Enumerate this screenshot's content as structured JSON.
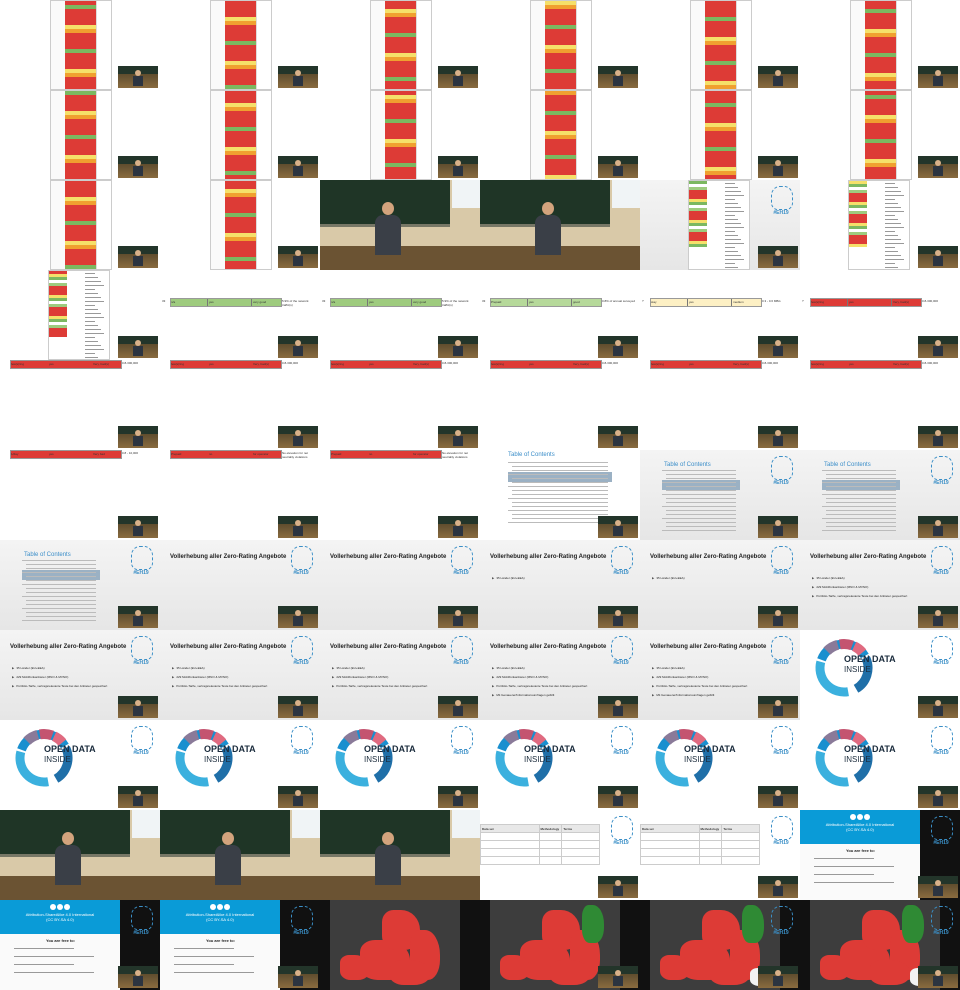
{
  "grid": {
    "cols": 6,
    "rows": 11
  },
  "slides": {
    "bar_rows": {
      "row1": [
        {
          "num": "33",
          "colors": [
            "#9ecb7e",
            "#9ecb7e",
            "#9ecb7e"
          ],
          "labels": [
            "n/a",
            "yes",
            "very good"
          ],
          "note": "5.9% of the network traffic(s)"
        },
        {
          "num": "33",
          "colors": [
            "#9ecb7e",
            "#9ecb7e",
            "#9ecb7e"
          ],
          "labels": [
            "n/a",
            "yes",
            "very good"
          ],
          "note": "5.9% of the network traffic(s)"
        },
        {
          "num": "33",
          "colors": [
            "#b6d99a",
            "#b6d99a",
            "#b6d99a"
          ],
          "labels": [
            "Prepaid",
            "yes",
            "good"
          ],
          "note": "0.8% of annual surveyed"
        },
        {
          "num": "?",
          "colors": [
            "#fdf0c4",
            "#fdf0c4",
            "#fdf0c4"
          ],
          "labels": [
            "stay",
            "yes",
            "medium"
          ],
          "note": "0.3 - 0.6 MB/s"
        },
        {
          "num": "?",
          "colors": [
            "#dd3b36",
            "#dd3b36",
            "#dd3b36"
          ],
          "labels": [
            "few(s)/ing",
            "yes",
            "Very, bad(s)"
          ],
          "note": "0.8-300,000"
        }
      ],
      "row2_label": "few(s)/ing",
      "row2_mid": "yes",
      "row2_right": "Very, bad(s)",
      "row2_note": "0.8-300,000",
      "row3": [
        {
          "labels": [
            "1/day",
            "yes",
            "Very bad",
            "evaluation for big companies"
          ],
          "note": "0.8 - 10,000"
        },
        {
          "labels": [
            "Prepaid",
            "no",
            "for operator"
          ],
          "note": "No elevation for net neutrality violations"
        },
        {
          "labels": [
            "Prepaid",
            "no",
            "for operator"
          ],
          "note": "No elevation for net neutrality violations"
        }
      ]
    },
    "toc_title": "Table of Contents",
    "zero_rating": {
      "title": "Vollerhebung aller Zero-Rating Angebote",
      "bullets": [
        "35 Länder (EU+EEA)",
        "229 Mobilfunkanbieter (MNO & MVNO)",
        "Portfolio-Tarife, vertragsrelevante Texte bei den Anbieter gespeichert",
        "Mit Genauerer/Informationsumfragen gefüllt"
      ]
    },
    "logo_tag": "#EH19",
    "open_data": {
      "line1": "OPEN DATA",
      "line2": "INSIDE"
    },
    "license": {
      "title_line1": "Attribution-ShareAlike 4.0 International",
      "title_line2": "(CC BY-SA 4.0)",
      "free_to": "You are free to:"
    },
    "table_header": [
      "Data set",
      "Methodology",
      "Terms"
    ]
  },
  "colors": {
    "red": "#dd3b36",
    "green": "#7cb860",
    "orange": "#f0a030",
    "yellow": "#f5e06a",
    "logo": "#3a8fc7",
    "license_blue": "#0a9bd7"
  }
}
